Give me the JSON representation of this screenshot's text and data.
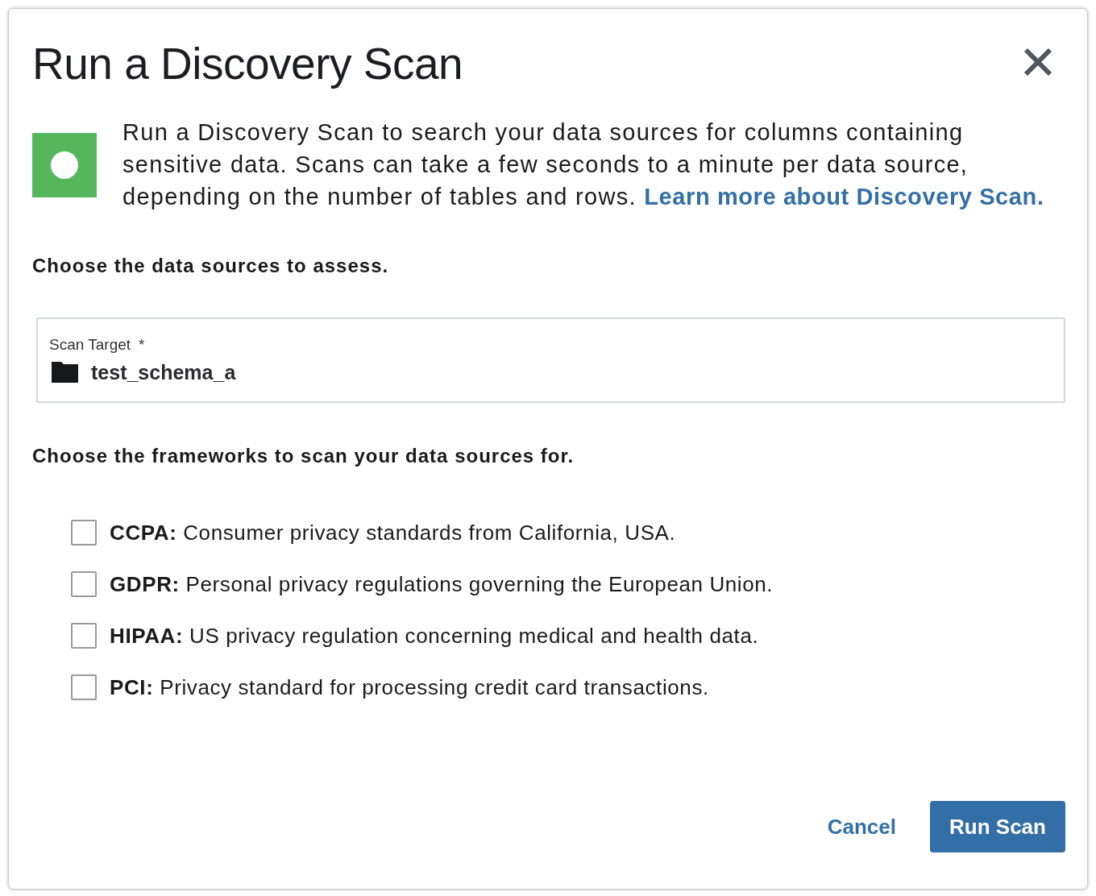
{
  "dialog": {
    "title": "Run a Discovery Scan"
  },
  "intro": {
    "text": "Run a Discovery Scan to search your data sources for columns containing sensitive data. Scans can take a few seconds to a minute per data source, depending on the number of tables and rows.",
    "link": "Learn more about Discovery Scan."
  },
  "sources_heading": "Choose the data sources to assess.",
  "scan_target": {
    "label": "Scan Target",
    "required_mark": "*",
    "value": "test_schema_a"
  },
  "frameworks_heading": "Choose the frameworks to scan your data sources for.",
  "frameworks": [
    {
      "label": "**CCPA:** Consumer privacy standards from California, USA.",
      "checked": false
    },
    {
      "label": "**GDPR:** Personal privacy regulations governing the European Union.",
      "checked": false
    },
    {
      "label": "**HIPAA:** US privacy regulation concerning medical and health data.",
      "checked": false
    },
    {
      "label": "**PCI:** Privacy standard for processing credit card transactions.",
      "checked": false
    }
  ],
  "buttons": [
    {
      "label": "Cancel",
      "kind": "link"
    },
    {
      "label": "Run Scan",
      "kind": "primary"
    }
  ]
}
